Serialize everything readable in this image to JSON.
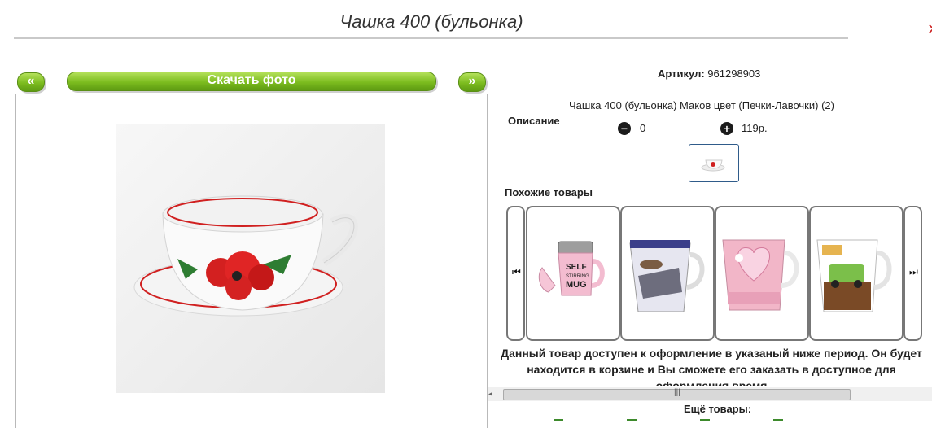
{
  "product": {
    "title": "Чашка 400 (бульонка)",
    "sku_label": "Артикул:",
    "sku_value": "961298903",
    "description_label": "Описание",
    "description_text": "Чашка 400 (бульонка) Маков цвет (Печки-Лавочки) (2)",
    "quantity": "0",
    "price": "119р."
  },
  "gallery": {
    "prev_label": "«",
    "download_label": "Скачать фото",
    "next_label": "»"
  },
  "similar": {
    "title": "Похожие товары",
    "items": [
      {
        "name": "Self stirring mug",
        "mug_text_1": "SELF",
        "mug_text_2": "STIRRING",
        "mug_text_3": "MUG"
      },
      {
        "name": "Mug with car print"
      },
      {
        "name": "Pink mug with heart"
      },
      {
        "name": "Mug with retro car"
      }
    ]
  },
  "availability_note": "Данный товар доступен к оформление в указаный ниже период. Он будет находится в корзине и Вы сможете его заказать в доступное для оформления время",
  "more_products_title": "Ещё товары:",
  "scrollbar": {
    "left_arrow": "◂",
    "grip": "|||"
  },
  "icons": {
    "minus": "minus-circle-icon",
    "plus": "plus-circle-icon",
    "prev": "skip-back-icon",
    "next": "skip-forward-icon"
  },
  "colors": {
    "button_green": "#7cbc1f",
    "poppy_red": "#d02020"
  }
}
